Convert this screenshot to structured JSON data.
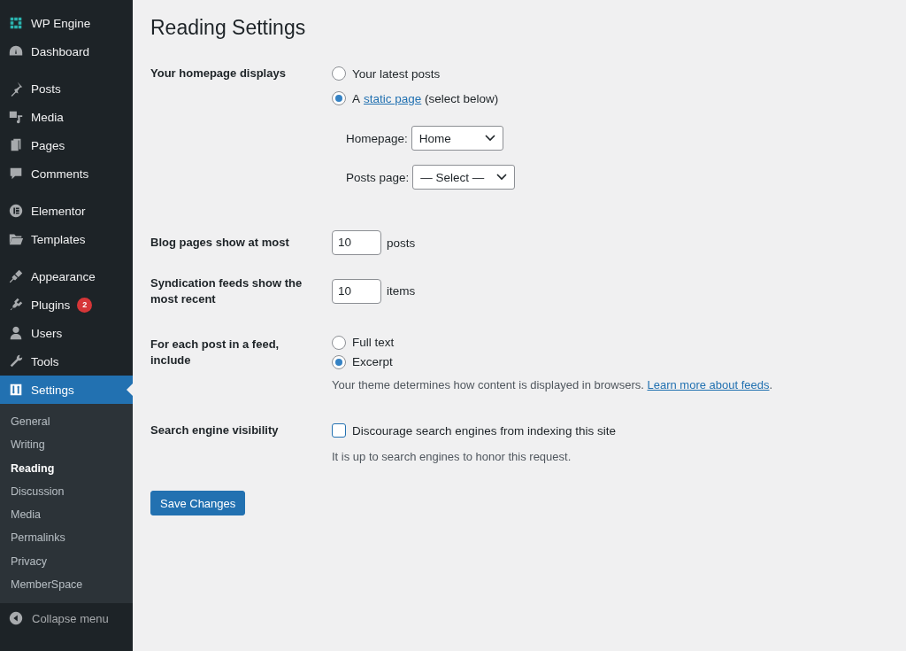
{
  "sidebar": {
    "groups": [
      [
        {
          "label": "WP Engine",
          "selected": false
        },
        {
          "label": "Dashboard",
          "selected": false
        }
      ],
      [
        {
          "label": "Posts",
          "selected": false
        },
        {
          "label": "Media",
          "selected": false
        },
        {
          "label": "Pages",
          "selected": false
        },
        {
          "label": "Comments",
          "selected": false
        }
      ],
      [
        {
          "label": "Elementor",
          "selected": false
        },
        {
          "label": "Templates",
          "selected": false
        }
      ],
      [
        {
          "label": "Appearance",
          "selected": false
        },
        {
          "label": "Plugins",
          "selected": false,
          "badge": "2"
        },
        {
          "label": "Users",
          "selected": false
        },
        {
          "label": "Tools",
          "selected": false
        },
        {
          "label": "Settings",
          "selected": true
        }
      ]
    ],
    "submenu": [
      {
        "label": "General",
        "selected": false
      },
      {
        "label": "Writing",
        "selected": false
      },
      {
        "label": "Reading",
        "selected": true
      },
      {
        "label": "Discussion",
        "selected": false
      },
      {
        "label": "Media",
        "selected": false
      },
      {
        "label": "Permalinks",
        "selected": false
      },
      {
        "label": "Privacy",
        "selected": false
      },
      {
        "label": "MemberSpace",
        "selected": false
      }
    ],
    "collapse": "Collapse menu"
  },
  "page": {
    "title": "Reading Settings",
    "homepage_displays": {
      "label": "Your homepage displays",
      "options": [
        {
          "text": "Your latest posts",
          "selected": false
        },
        {
          "text": "A",
          "link": "static page",
          "after": "(select below)",
          "selected": true
        }
      ],
      "selects": [
        {
          "label": "Homepage:",
          "value": "Home"
        },
        {
          "label": "Posts page:",
          "value": "— Select —"
        }
      ]
    },
    "blog_pages": {
      "label": "Blog pages show at most",
      "value": "10",
      "unit": "posts"
    },
    "syndication": {
      "label": "Syndication feeds show the most recent",
      "value": "10",
      "unit": "items"
    },
    "feed_content": {
      "label": "For each post in a feed, include",
      "options": [
        {
          "text": "Full text",
          "selected": false
        },
        {
          "text": "Excerpt",
          "selected": true
        }
      ],
      "note": "Your theme determines how content is displayed in browsers.",
      "link": "Learn more about feeds",
      "after": "."
    },
    "search_visibility": {
      "label": "Search engine visibility",
      "checkbox": {
        "text": "Discourage search engines from indexing this site",
        "checked": false
      },
      "note": "It is up to search engines to honor this request."
    },
    "save": "Save Changes"
  }
}
